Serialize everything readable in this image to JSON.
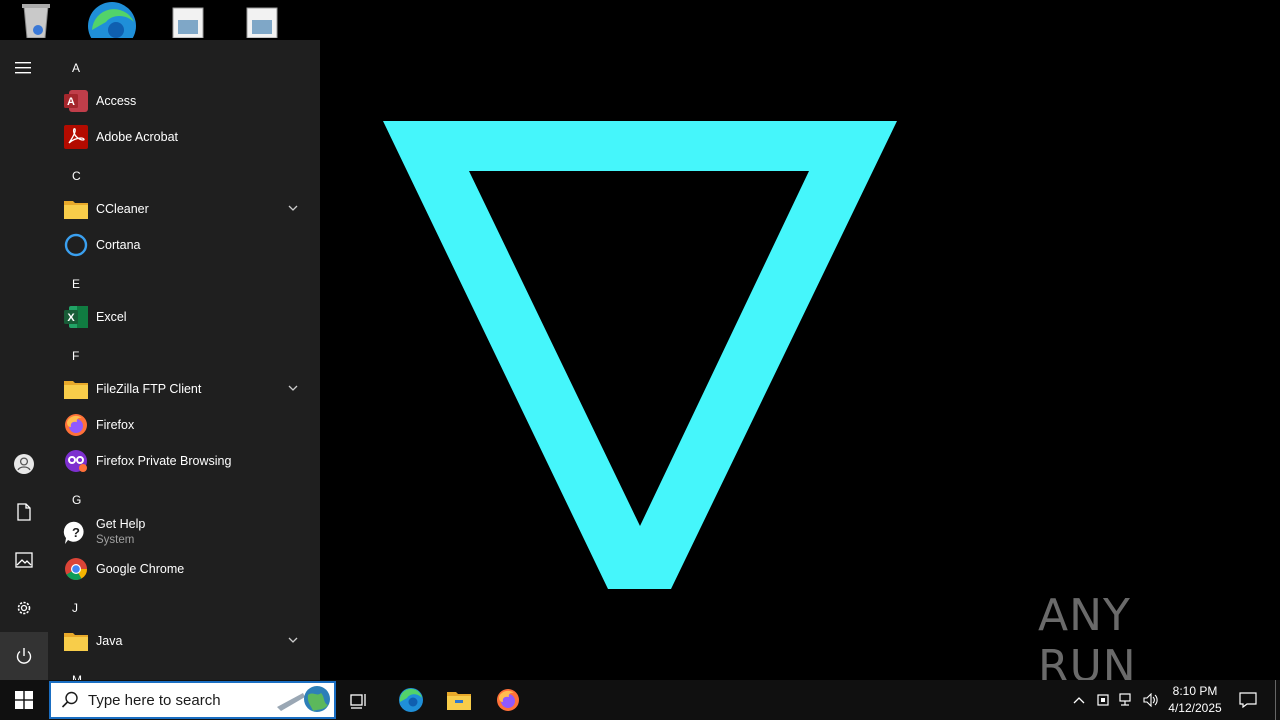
{
  "desktop": {
    "icons": [
      {
        "name": "recycle-bin-icon"
      },
      {
        "name": "edge-icon"
      },
      {
        "name": "file-icon-1"
      },
      {
        "name": "file-icon-2"
      }
    ],
    "watermark": "ANY RUN",
    "wallpaper_color": "#45f6fb"
  },
  "start_menu": {
    "groups": [
      {
        "letter": "A",
        "apps": [
          {
            "label": "Access",
            "icon": "access-icon"
          },
          {
            "label": "Adobe Acrobat",
            "icon": "acrobat-icon"
          }
        ]
      },
      {
        "letter": "C",
        "apps": [
          {
            "label": "CCleaner",
            "icon": "folder-icon",
            "expandable": true
          },
          {
            "label": "Cortana",
            "icon": "cortana-icon"
          }
        ]
      },
      {
        "letter": "E",
        "apps": [
          {
            "label": "Excel",
            "icon": "excel-icon"
          }
        ]
      },
      {
        "letter": "F",
        "apps": [
          {
            "label": "FileZilla FTP Client",
            "icon": "folder-icon",
            "expandable": true
          },
          {
            "label": "Firefox",
            "icon": "firefox-icon"
          },
          {
            "label": "Firefox Private Browsing",
            "icon": "firefox-private-icon"
          }
        ]
      },
      {
        "letter": "G",
        "apps": [
          {
            "label": "Get Help",
            "sub": "System",
            "icon": "get-help-icon"
          },
          {
            "label": "Google Chrome",
            "icon": "chrome-icon"
          }
        ]
      },
      {
        "letter": "J",
        "apps": [
          {
            "label": "Java",
            "icon": "folder-icon",
            "expandable": true
          }
        ]
      },
      {
        "letter": "M",
        "apps": []
      }
    ]
  },
  "taskbar": {
    "search_placeholder": "Type here to search",
    "time": "8:10 PM",
    "date": "4/12/2025"
  }
}
